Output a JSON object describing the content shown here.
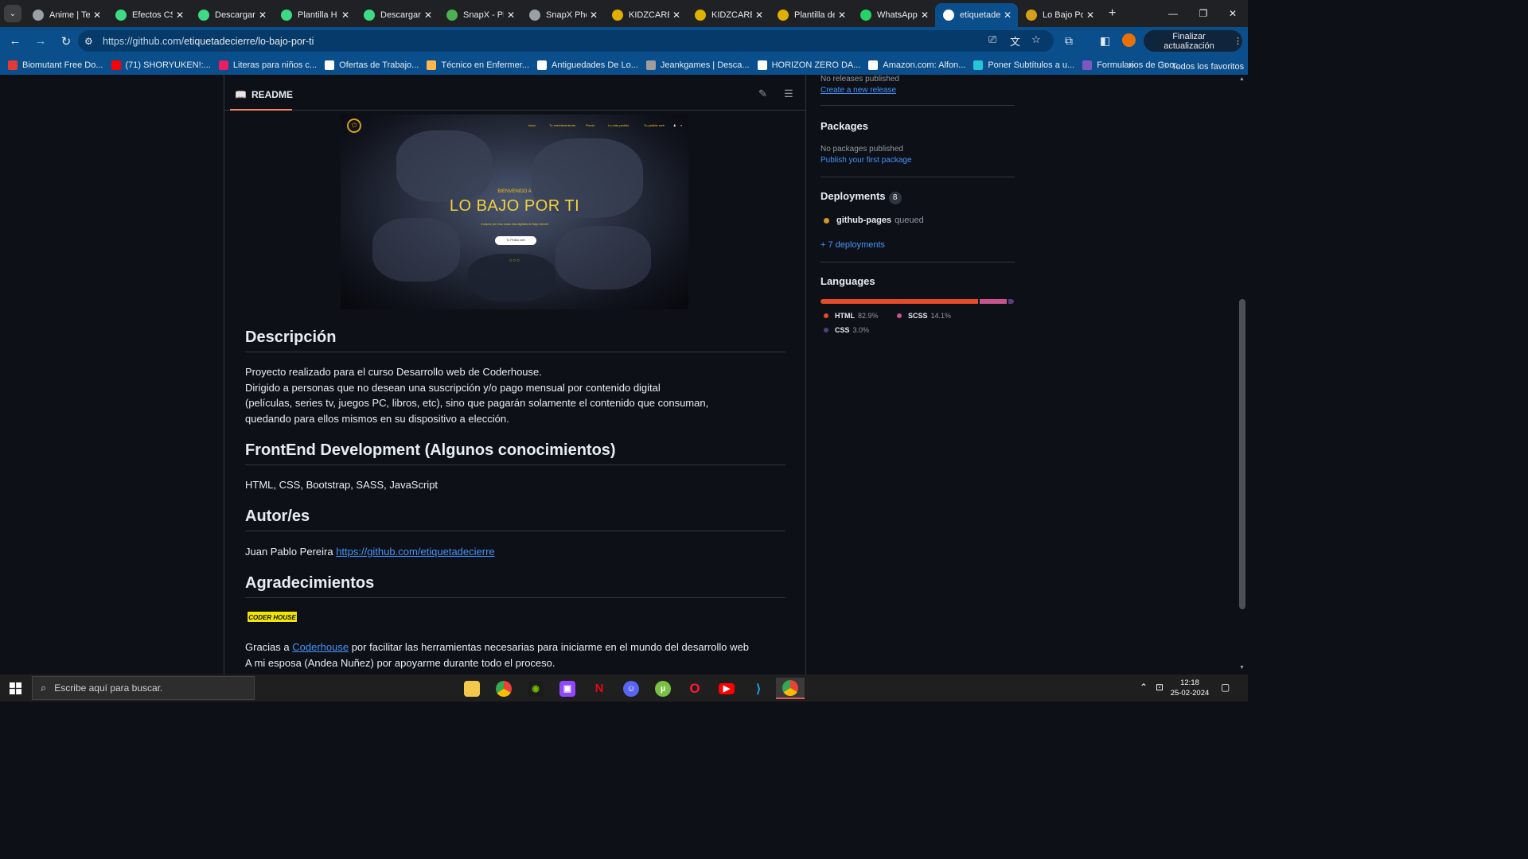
{
  "browser": {
    "tabs": [
      {
        "label": "Anime | Te",
        "icon": "globe-icon",
        "color": "#9aa0a6"
      },
      {
        "label": "Efectos CS",
        "icon": "codepen-icon",
        "color": "#3ddc84"
      },
      {
        "label": "Descargar",
        "icon": "codepen-icon",
        "color": "#3ddc84"
      },
      {
        "label": "Plantilla H",
        "icon": "codepen-icon",
        "color": "#3ddc84"
      },
      {
        "label": "Descargar",
        "icon": "codepen-icon",
        "color": "#3ddc84"
      },
      {
        "label": "SnapX - Pl",
        "icon": "snapx-icon",
        "color": "#4caf50"
      },
      {
        "label": "SnapX Pho",
        "icon": "globe-icon",
        "color": "#9aa0a6"
      },
      {
        "label": "KIDZCARE",
        "icon": "kidzcare-icon",
        "color": "#e0b000"
      },
      {
        "label": "KIDZCARE",
        "icon": "kidzcare-icon",
        "color": "#e0b000"
      },
      {
        "label": "Plantilla de",
        "icon": "kidzcare-icon",
        "color": "#e0b000"
      },
      {
        "label": "WhatsApp",
        "icon": "whatsapp-icon",
        "color": "#25d366"
      },
      {
        "label": "etiquetade",
        "icon": "github-icon",
        "color": "#ffffff",
        "active": true
      },
      {
        "label": "Lo Bajo Po",
        "icon": "lobajo-icon",
        "color": "#d4a017"
      }
    ],
    "url_host": "https://github.com/",
    "url_path": "etiquetadecierre/lo-bajo-por-ti",
    "update_label": "Finalizar actualización",
    "bookmarks": [
      {
        "label": "Biomutant Free Do...",
        "color": "#e53935"
      },
      {
        "label": "(71) SHORYUKEN!:...",
        "color": "#ff0000"
      },
      {
        "label": "Literas para niños c...",
        "color": "#e91e63"
      },
      {
        "label": "Ofertas de Trabajo...",
        "color": "#ffffff"
      },
      {
        "label": "Técnico en Enfermer...",
        "color": "#ffb74d"
      },
      {
        "label": "Antiguedades De Lo...",
        "color": "#ffffff"
      },
      {
        "label": "Jeankgames | Desca...",
        "color": "#9e9e9e"
      },
      {
        "label": "HORIZON ZERO DA...",
        "color": "#ffffff"
      },
      {
        "label": "Amazon.com: Alfon...",
        "color": "#ffffff"
      },
      {
        "label": "Poner Subtítulos a u...",
        "color": "#26c6da"
      },
      {
        "label": "Formularios de Goo...",
        "color": "#7e57c2"
      }
    ],
    "bookmarks_overflow": "»",
    "all_bookmarks": "Todos los favoritos"
  },
  "readme": {
    "tab_label": "README",
    "hero": {
      "nav": [
        "Inicio",
        "Tu entretenimiento",
        "Precio",
        "Lo más pedido",
        "Tu pedido web"
      ],
      "small": "BIENVENIDO A",
      "title": "LO BAJO POR TI",
      "sub": "Comprar por ti las cosas más digitales de Bajo Internet",
      "button": "Tu Pedido web",
      "dots": "○○○"
    },
    "h_descripcion": "Descripción",
    "p_descripcion": [
      "Proyecto realizado para el curso Desarrollo web de Coderhouse.",
      "Dirigido a personas que no desean una suscripción y/o pago mensual por contenido digital",
      "(películas, series tv, juegos PC, libros, etc), sino que pagarán solamente el contenido que consuman,",
      "quedando para ellos mismos en su dispositivo a elección."
    ],
    "h_frontend": "FrontEnd Development (Algunos conocimientos)",
    "p_frontend": "HTML, CSS, Bootstrap, SASS, JavaScript",
    "h_autor": "Autor/es",
    "autor_name": "Juan Pablo Pereira ",
    "autor_link": "https://github.com/etiquetadecierre",
    "h_agradecimientos": "Agradecimientos",
    "coder_badge": "CODER HOUSE",
    "gracias_pre": "Gracias a ",
    "gracias_link": "Coderhouse",
    "gracias_post": " por facilitar las herramientas necesarias para iniciarme en el mundo del desarrollo web",
    "esposa": "A mi esposa (Andea Nuñez) por apoyarme durante todo el proceso."
  },
  "sidebar": {
    "releases_muted": "No releases published",
    "create_release": "Create a new release",
    "packages_title": "Packages",
    "packages_muted": "No packages published",
    "publish_package": "Publish your first package",
    "deployments_title": "Deployments",
    "deployments_count": "8",
    "deployment_name": "github-pages",
    "deployment_status": "queued",
    "more_deployments": "+ 7 deployments",
    "languages_title": "Languages",
    "languages": [
      {
        "name": "HTML",
        "percent": "82.9%",
        "value": 82.9,
        "color": "#e34c26"
      },
      {
        "name": "SCSS",
        "percent": "14.1%",
        "value": 14.1,
        "color": "#c6538c"
      },
      {
        "name": "CSS",
        "percent": "3.0%",
        "value": 3.0,
        "color": "#563d7c"
      }
    ]
  },
  "taskbar": {
    "search_placeholder": "Escribe aquí para buscar.",
    "time": "12:18",
    "date": "25-02-2024"
  }
}
